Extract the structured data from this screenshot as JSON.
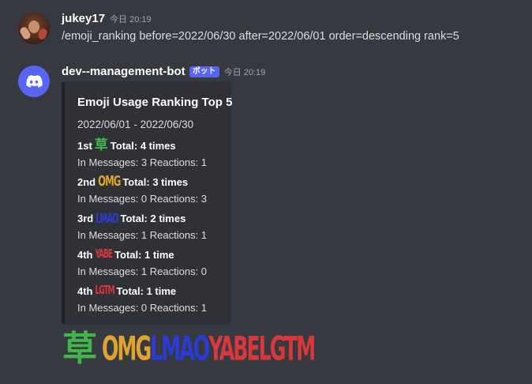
{
  "messages": {
    "user": {
      "name": "jukey17",
      "timestamp": "今日 20:19",
      "text": "/emoji_ranking before=2022/06/30 after=2022/06/01 order=descending rank=5"
    },
    "bot": {
      "name": "dev--management-bot",
      "tag": "ボット",
      "timestamp": "今日 20:19"
    }
  },
  "embed": {
    "title": "Emoji Usage Ranking Top 5",
    "description": "2022/06/01 - 2022/06/30",
    "fields": [
      {
        "rank": "1st",
        "emoji": "草",
        "emoji_icon": "kusa-emoji",
        "total": "Total: 4 times",
        "value": "In Messages: 3 Reactions: 1"
      },
      {
        "rank": "2nd",
        "emoji": "OMG",
        "emoji_icon": "omg-emoji",
        "total": "Total: 3 times",
        "value": "In Messages: 0 Reactions: 3"
      },
      {
        "rank": "3rd",
        "emoji": "LMAO",
        "emoji_icon": "lmao-emoji",
        "total": "Total: 2 times",
        "value": "In Messages: 1 Reactions: 1"
      },
      {
        "rank": "4th",
        "emoji": "YABE",
        "emoji_icon": "yabe-emoji",
        "total": "Total: 1 time",
        "value": "In Messages: 1 Reactions: 0"
      },
      {
        "rank": "4th",
        "emoji": "LGTM",
        "emoji_icon": "lgtm-emoji",
        "total": "Total: 1 time",
        "value": "In Messages: 0 Reactions: 1"
      }
    ]
  },
  "reactions": [
    {
      "label": "草",
      "icon": "kusa-emoji"
    },
    {
      "label": "OMG",
      "icon": "omg-emoji"
    },
    {
      "label": "LMAO",
      "icon": "lmao-emoji"
    },
    {
      "label": "YABE",
      "icon": "yabe-emoji"
    },
    {
      "label": "LGTM",
      "icon": "lgtm-emoji"
    }
  ],
  "colors": {
    "background": "#36393f",
    "embed_background": "#2f3136",
    "bot_accent": "#5865f2",
    "kusa": "#43b54b",
    "omg": "#e0a32e",
    "lmao": "#2b3bd6",
    "yabe": "#d8373c",
    "lgtm": "#d8373c"
  }
}
